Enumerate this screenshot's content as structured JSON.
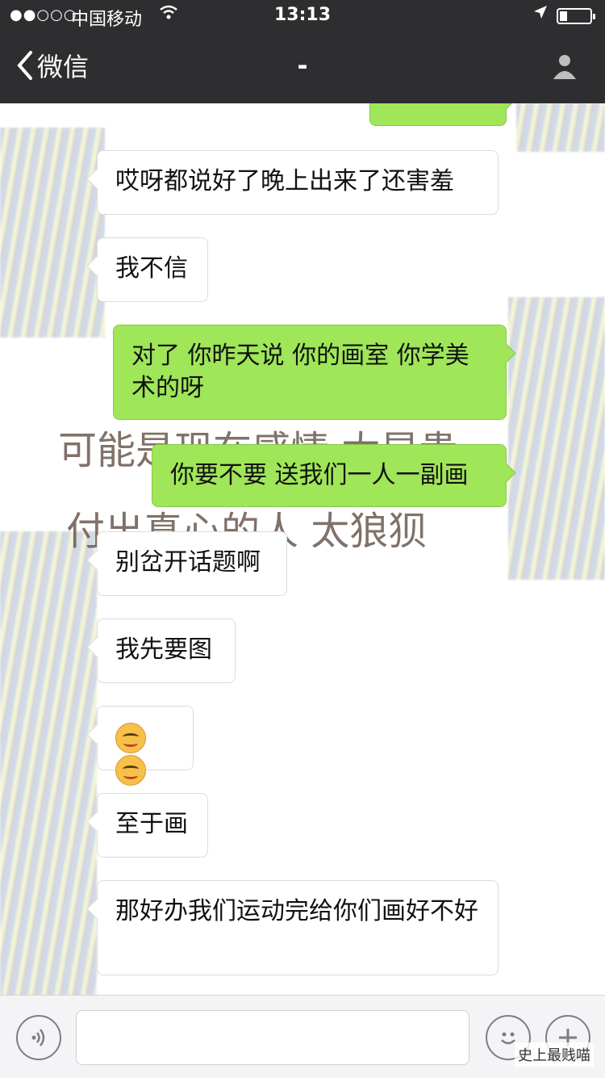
{
  "status_bar": {
    "signal": "●●○○○",
    "carrier": "中国移动",
    "time": "13:13",
    "battery_level": 0.25
  },
  "nav": {
    "back_label": "微信",
    "title": "-"
  },
  "watermark_lines": [
    "可能是现在感情 太昂贵",
    "付出真心的人 太狼狈"
  ],
  "messages": [
    {
      "side": "left",
      "text": "哎呀都说好了晚上出来了还害羞"
    },
    {
      "side": "left",
      "text": "我不信"
    },
    {
      "side": "right",
      "text": "对了 你昨天说 你的画室 你学美术的呀"
    },
    {
      "side": "right",
      "text": "你要不要 送我们一人一副画"
    },
    {
      "side": "left",
      "text": "别岔开话题啊"
    },
    {
      "side": "left",
      "text": "我先要图"
    },
    {
      "side": "left",
      "emoji_count": 2
    },
    {
      "side": "left",
      "text": "至于画"
    },
    {
      "side": "left",
      "text": "那好办我们运动完给你们画好不好"
    }
  ],
  "input_bar": {
    "footer_watermark": "史上最贱喵"
  },
  "colors": {
    "nav_bg": "#2e2e31",
    "bubble_green": "#9fe658",
    "bubble_white": "#ffffff"
  }
}
